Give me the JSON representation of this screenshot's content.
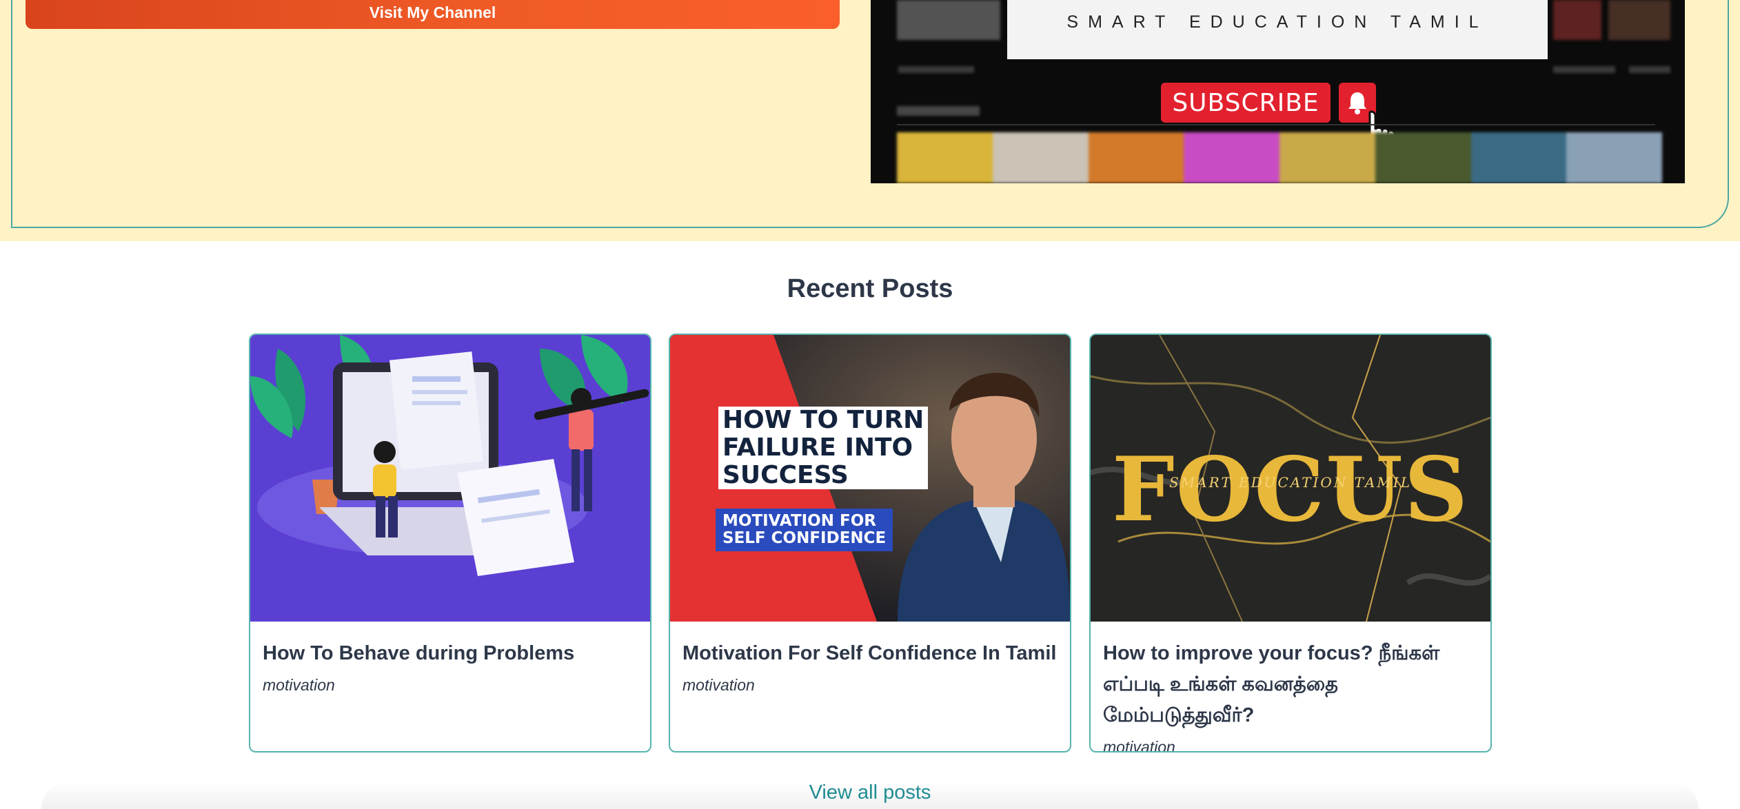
{
  "hero": {
    "visit_button": "Visit My Channel"
  },
  "promo": {
    "brand": "SMART EDUCATION TAMIL",
    "subscribe": "SUBSCRIBE"
  },
  "recent": {
    "title": "Recent Posts",
    "view_all": "View all posts",
    "posts": [
      {
        "title": "How To Behave during Problems",
        "category": "motivation",
        "thumb": "illustration-writing-icon"
      },
      {
        "title": "Motivation For Self Confidence In Tamil",
        "category": "motivation",
        "thumb_text": [
          "HOW TO TURN",
          "FAILURE INTO",
          "SUCCESS"
        ],
        "thumb_sub": [
          "MOTIVATION FOR",
          "SELF CONFIDENCE"
        ]
      },
      {
        "title": "How to improve your focus? நீங்கள் எப்படி உங்கள் கவனத்தை மேம்படுத்துவீர்?",
        "category": "motivation",
        "thumb_word": "FOCUS",
        "thumb_brand": "SMART EDUCATION TAMIL"
      }
    ]
  },
  "colors": {
    "hero_bg": "#fff2c4",
    "accent": "#4aa7a3",
    "link": "#1f8c93",
    "youtube_red": "#e3212e"
  }
}
